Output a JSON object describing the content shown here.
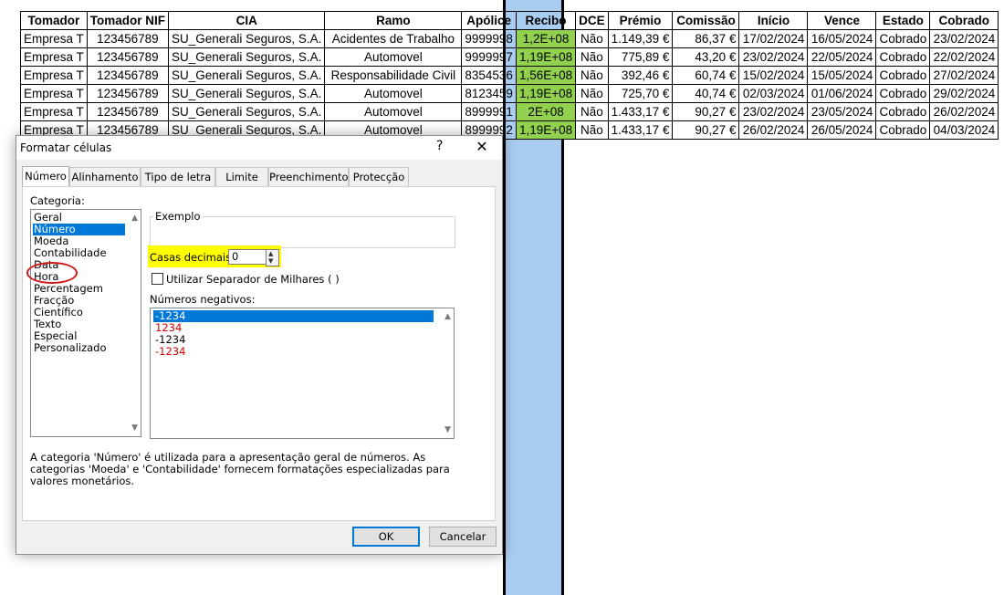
{
  "sheet": {
    "headers": [
      "Tomador",
      "Tomador NIF",
      "CIA",
      "Ramo",
      "Apólice",
      "Recibo",
      "DCE",
      "Prémio",
      "Comissão",
      "Início",
      "Vence",
      "Estado",
      "Cobrado"
    ],
    "rows": [
      [
        "Empresa T",
        "123456789",
        "SU_Generali Seguros, S.A.",
        "Acidentes de Trabalho",
        "9999998",
        "1,2E+08",
        "Não",
        "1.149,39 €",
        "86,37 €",
        "17/02/2024",
        "16/05/2024",
        "Cobrado",
        "23/02/2024"
      ],
      [
        "Empresa T",
        "123456789",
        "SU_Generali Seguros, S.A.",
        "Automovel",
        "9999997",
        "1,19E+08",
        "Não",
        "775,89 €",
        "43,20 €",
        "23/02/2024",
        "22/05/2024",
        "Cobrado",
        "22/02/2024"
      ],
      [
        "Empresa T",
        "123456789",
        "SU_Generali Seguros, S.A.",
        "Responsabilidade Civil",
        "8354536",
        "1,56E+08",
        "Não",
        "392,46 €",
        "60,74 €",
        "15/02/2024",
        "15/05/2024",
        "Cobrado",
        "27/02/2024"
      ],
      [
        "Empresa T",
        "123456789",
        "SU_Generali Seguros, S.A.",
        "Automovel",
        "8123459",
        "1,19E+08",
        "Não",
        "725,70 €",
        "40,74 €",
        "02/03/2024",
        "01/06/2024",
        "Cobrado",
        "29/02/2024"
      ],
      [
        "Empresa T",
        "123456789",
        "SU_Generali Seguros, S.A.",
        "Automovel",
        "8999991",
        "2E+08",
        "Não",
        "1.433,17 €",
        "90,27 €",
        "23/02/2024",
        "23/05/2024",
        "Cobrado",
        "26/02/2024"
      ],
      [
        "Empresa T",
        "123456789",
        "SU_Generali Seguros, S.A.",
        "Automovel",
        "8999992",
        "1,19E+08",
        "Não",
        "1.433,17 €",
        "90,27 €",
        "26/02/2024",
        "26/05/2024",
        "Cobrado",
        "04/03/2024"
      ]
    ],
    "colors": {
      "recibo_fill": "#92d050",
      "column_select": "#a9cdf0"
    }
  },
  "dialog": {
    "title": "Formatar células",
    "help": "?",
    "close": "✕",
    "tabs": [
      "Número",
      "Alinhamento",
      "Tipo de letra",
      "Limite",
      "Preenchimento",
      "Protecção"
    ],
    "active_tab": "Número",
    "category_label": "Categoria:",
    "categories": [
      "Geral",
      "Número",
      "Moeda",
      "Contabilidade",
      "Data",
      "Hora",
      "Percentagem",
      "Fracção",
      "Científico",
      "Texto",
      "Especial",
      "Personalizado"
    ],
    "selected_category": "Número",
    "example_label": "Exemplo",
    "decimals_label": "Casas decimais:",
    "decimals_value": "0",
    "thousands_label": "Utilizar Separador de Milhares ( )",
    "negatives_label": "Números negativos:",
    "negatives": [
      "-1234",
      "1234",
      "-1234",
      "-1234"
    ],
    "description": "A categoria 'Número' é utilizada para a apresentação geral de números. As categorias 'Moeda' e 'Contabilidade' fornecem formatações especializadas para valores monetários.",
    "ok": "OK",
    "cancel": "Cancelar",
    "colors": {
      "accent": "#0078d7",
      "highlight": "#ffff00",
      "circle": "#d01818",
      "negative_red": "#d40000"
    }
  }
}
